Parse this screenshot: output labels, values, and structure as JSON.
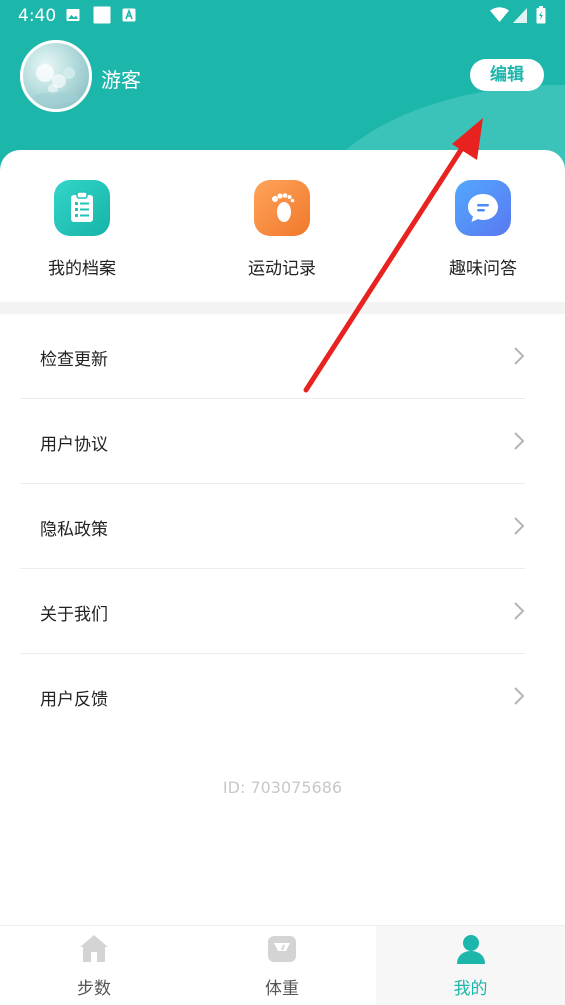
{
  "status_bar": {
    "time": "4:40"
  },
  "profile": {
    "username": "游客",
    "edit_label": "编辑"
  },
  "quick_actions": [
    {
      "label": "我的档案",
      "icon": "clipboard-icon",
      "color": "#1fc3b8"
    },
    {
      "label": "运动记录",
      "icon": "footprint-icon",
      "color": "#f5893c"
    },
    {
      "label": "趣味问答",
      "icon": "chat-bubble-icon",
      "color": "#4d8cf7"
    }
  ],
  "menu": [
    {
      "label": "检查更新"
    },
    {
      "label": "用户协议"
    },
    {
      "label": "隐私政策"
    },
    {
      "label": "关于我们"
    },
    {
      "label": "用户反馈"
    }
  ],
  "user_id": "ID: 703075686",
  "tabs": [
    {
      "label": "步数",
      "icon": "home-icon",
      "active": false
    },
    {
      "label": "体重",
      "icon": "scale-icon",
      "active": false
    },
    {
      "label": "我的",
      "icon": "person-icon",
      "active": true
    }
  ],
  "colors": {
    "accent": "#1cb6ab",
    "tab_inactive": "#555555",
    "annotation_arrow": "#e8231f"
  }
}
